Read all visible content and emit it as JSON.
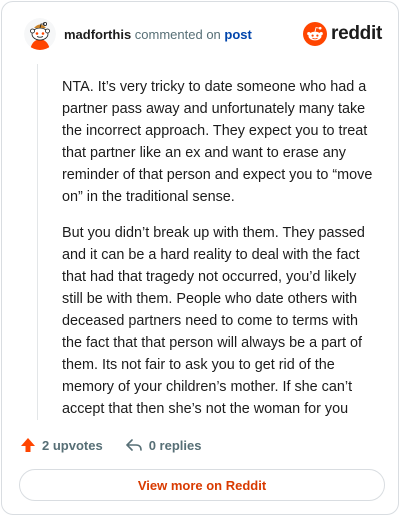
{
  "header": {
    "username": "madforthis",
    "action_text": "commented on",
    "post_link": "post",
    "brand": "reddit"
  },
  "comment": {
    "paragraphs": [
      "NTA. It’s very tricky to date someone who had a partner pass away and unfortunately many take the incorrect approach. They expect you to treat that partner like an ex and want to erase any reminder of that person and expect you to “move on” in the traditional sense.",
      "But you didn’t break up with them. They passed and it can be a hard reality to deal with the fact that had that tragedy not occurred, you’d likely still be with them. People who date others with deceased partners need to come to terms with the fact that that person will always be a part of them. Its not fair to ask you to get rid of the memory of your children’s mother. If she can’t accept that then she’s not the woman for you"
    ]
  },
  "actions": {
    "upvotes_label": "2 upvotes",
    "replies_label": "0 replies"
  },
  "footer": {
    "view_more_label": "View more on Reddit"
  },
  "colors": {
    "reddit_orange": "#ff4500",
    "link_blue": "#0045ac",
    "button_text": "#d93a00"
  },
  "icons": {
    "avatar": "snoo-avatar",
    "brand_logo": "reddit-logo-icon",
    "upvote": "upvote-arrow-icon",
    "reply": "reply-arrow-icon"
  }
}
